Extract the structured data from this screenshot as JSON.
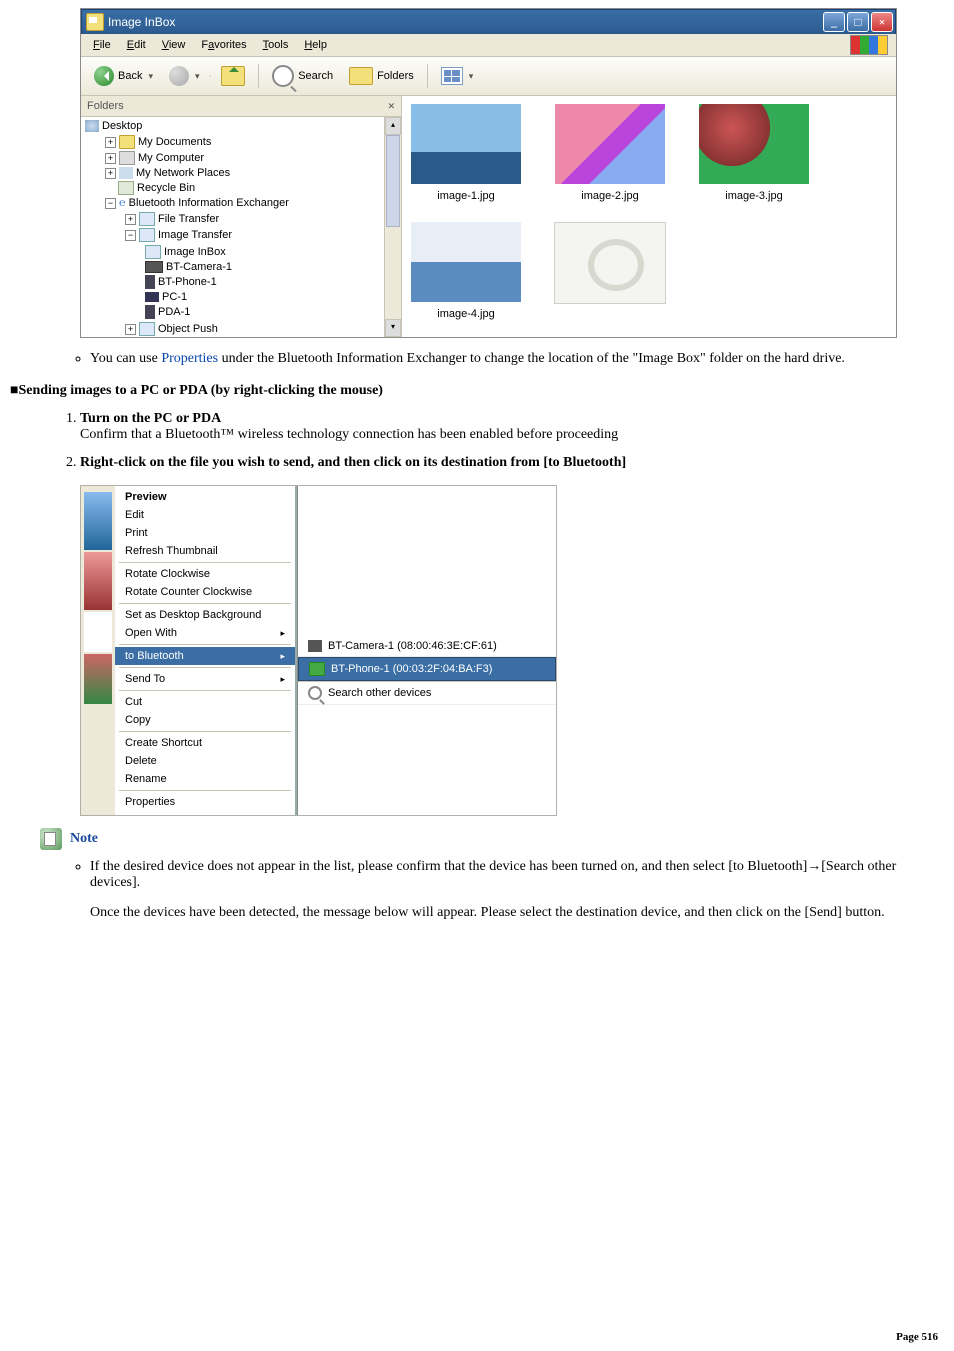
{
  "screenshot1": {
    "window_title": "Image InBox",
    "menubar": [
      "File",
      "Edit",
      "View",
      "Favorites",
      "Tools",
      "Help"
    ],
    "toolbar": {
      "back": "Back",
      "search": "Search",
      "folders": "Folders"
    },
    "folders_pane_title": "Folders",
    "tree": {
      "desktop": "Desktop",
      "mydocs": "My Documents",
      "mycomp": "My Computer",
      "mynet": "My Network Places",
      "recycle": "Recycle Bin",
      "btx": "Bluetooth Information Exchanger",
      "filetrans": "File Transfer",
      "imgtrans": "Image Transfer",
      "imginbox": "Image InBox",
      "btcam": "BT-Camera-1",
      "btph": "BT-Phone-1",
      "pc1": "PC-1",
      "pda1": "PDA-1",
      "objpush": "Object Push"
    },
    "thumbs": {
      "i1": "image-1.jpg",
      "i2": "image-2.jpg",
      "i3": "image-3.jpg",
      "i4": "image-4.jpg"
    }
  },
  "body1": {
    "bullet1_a": "You can use ",
    "bullet1_link": "Properties",
    "bullet1_b": " under the Bluetooth Information Exchanger to change the location of the \"Image Box\" folder on the hard drive.",
    "section": "■Sending images to a PC or PDA (by right-clicking the mouse)",
    "step1_t": "Turn on the PC or PDA",
    "step1_d": "Confirm that a Bluetooth™ wireless technology connection has been enabled before proceeding",
    "step2_t": "Right-click on the file you wish to send, and then click on its destination from [to Bluetooth]"
  },
  "ctxmenu": {
    "items": [
      "Preview",
      "Edit",
      "Print",
      "Refresh Thumbnail",
      "Rotate Clockwise",
      "Rotate Counter Clockwise",
      "Set as Desktop Background",
      "Open With",
      "to Bluetooth",
      "Send To",
      "Cut",
      "Copy",
      "Create Shortcut",
      "Delete",
      "Rename",
      "Properties"
    ],
    "sub": {
      "cam": "BT-Camera-1 (08:00:46:3E:CF:61)",
      "ph": "BT-Phone-1 (00:03:2F:04:BA:F3)",
      "search": "Search other devices"
    }
  },
  "body2": {
    "note_label": "Note",
    "bullet2_a": "If the desired device does not appear in the list, please confirm that the device has been turned on, and then select [to Bluetooth]→[Search other devices].",
    "bullet2_b": "Once the devices have been detected, the message below will appear. Please select the destination device, and then click on the [Send] button."
  },
  "page_no": "Page 516"
}
